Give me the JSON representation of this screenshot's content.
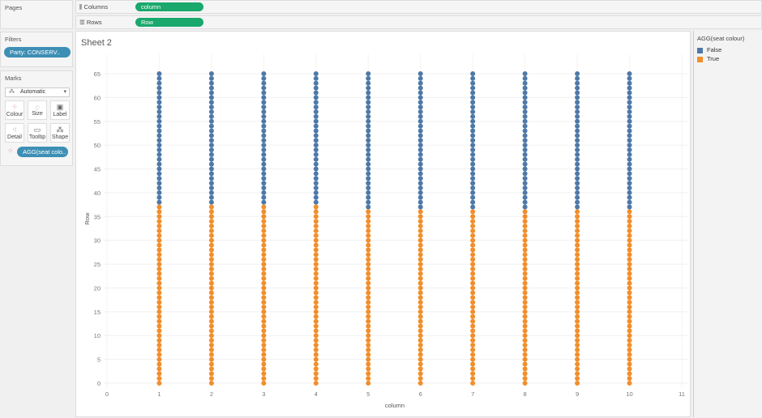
{
  "pages": {
    "title": "Pages"
  },
  "filters": {
    "title": "Filters",
    "pill": "Party: CONSERV.."
  },
  "marks": {
    "title": "Marks",
    "type": "Automatic",
    "cards": [
      "Colour",
      "Size",
      "Label",
      "Detail",
      "Tooltip",
      "Shape"
    ],
    "pill": "AGG(seat colo.."
  },
  "shelves": {
    "columns_label": "Columns",
    "columns_pill": "column",
    "rows_label": "Rows",
    "rows_pill": "Row"
  },
  "sheet": {
    "title": "Sheet 2"
  },
  "legend": {
    "title": "AGG(seat colour)",
    "items": [
      {
        "label": "False",
        "color": "#4e79a7"
      },
      {
        "label": "True",
        "color": "#f28e2b"
      }
    ]
  },
  "chart_data": {
    "type": "scatter",
    "xlabel": "column",
    "ylabel": "Row",
    "xlim": [
      0,
      11
    ],
    "ylim": [
      0,
      65
    ],
    "xticks": [
      "0",
      "1",
      "2",
      "3",
      "4",
      "5",
      "6",
      "7",
      "8",
      "9",
      "10",
      "11"
    ],
    "yticks": [
      "0",
      "5",
      "10",
      "15",
      "20",
      "25",
      "30",
      "35",
      "40",
      "45",
      "50",
      "55",
      "60",
      "65"
    ],
    "columns": [
      1,
      2,
      3,
      4,
      5,
      6,
      7,
      8,
      9,
      10
    ],
    "rows_range": [
      0,
      65
    ],
    "true_max_row": [
      37,
      37,
      37,
      37,
      36,
      36,
      36,
      36,
      36,
      36
    ],
    "colors": {
      "True": "#f28e2b",
      "False": "#4e79a7"
    },
    "grid": true
  }
}
